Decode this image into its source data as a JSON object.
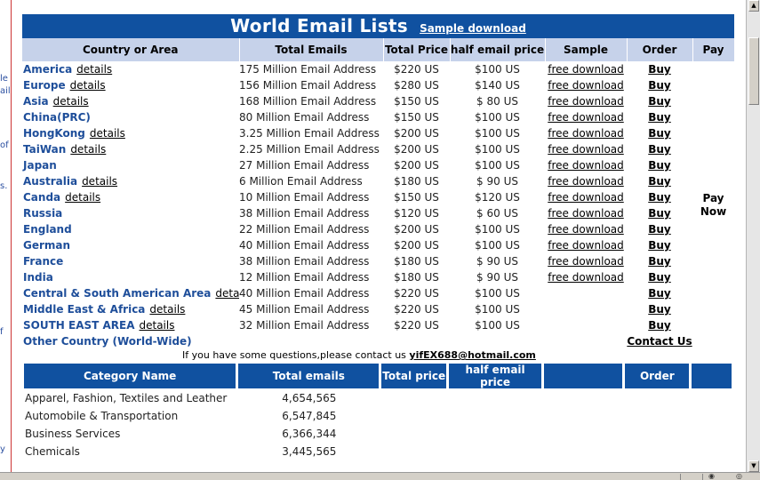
{
  "left_sidebar_fragments": [
    "le",
    "ail",
    "of",
    "s.",
    "f",
    "y"
  ],
  "banner": {
    "title": "World Email Lists",
    "sample_link": "Sample download"
  },
  "headers": [
    "Country or Area",
    "Total Emails",
    "Total Price",
    "half email price",
    "Sample",
    "Order",
    "Pay"
  ],
  "rows": [
    {
      "country": "America",
      "details": "details",
      "total": "175 Million Email Address",
      "price": "$220 US",
      "half": "$100 US",
      "sample": "free download",
      "order": "Buy"
    },
    {
      "country": "Europe",
      "details": "details",
      "total": "156 Million Email Address",
      "price": "$280 US",
      "half": "$140 US",
      "sample": "free download",
      "order": "Buy"
    },
    {
      "country": "Asia",
      "details": "details",
      "total": "168 Million Email Address",
      "price": "$150 US",
      "half": "$  80 US",
      "sample": "free download",
      "order": "Buy"
    },
    {
      "country": "China(PRC)",
      "details": "",
      "total": "80  Million Email Address",
      "price": "$150 US",
      "half": "$100 US",
      "sample": "free download",
      "order": "Buy"
    },
    {
      "country": "HongKong",
      "details": "details",
      "total": "3.25 Million Email Address",
      "price": "$200 US",
      "half": "$100 US",
      "sample": "free download",
      "order": "Buy"
    },
    {
      "country": "TaiWan",
      "details": "details",
      "total": "2.25 Million Email Address",
      "price": "$200 US",
      "half": "$100 US",
      "sample": "free download",
      "order": "Buy"
    },
    {
      "country": "Japan",
      "details": "",
      "total": "27   Million Email Address",
      "price": "$200 US",
      "half": "$100 US",
      "sample": "free download",
      "order": "Buy"
    },
    {
      "country": "Australia",
      "details": "details",
      "total": "6     Million Email Address",
      "price": "$180 US",
      "half": "$ 90 US",
      "sample": "free download",
      "order": "Buy"
    },
    {
      "country": "Canda",
      "details": "details",
      "total": "10   Million Email Address",
      "price": "$150 US",
      "half": "$120 US",
      "sample": "free download",
      "order": "Buy"
    },
    {
      "country": "Russia",
      "details": "",
      "total": "38   Million Email Address",
      "price": "$120 US",
      "half": "$  60 US",
      "sample": "free download",
      "order": "Buy"
    },
    {
      "country": "England",
      "details": "",
      "total": "22  Million Email Address",
      "price": "$200 US",
      "half": "$100 US",
      "sample": "free download",
      "order": "Buy"
    },
    {
      "country": "German",
      "details": "",
      "total": "40   Million Email Address",
      "price": "$200 US",
      "half": "$100 US",
      "sample": "free download",
      "order": "Buy"
    },
    {
      "country": "France",
      "details": "",
      "total": "38   Million Email Address",
      "price": "$180 US",
      "half": "$  90 US",
      "sample": "free download",
      "order": "Buy"
    },
    {
      "country": "India",
      "details": "",
      "total": "12   Million Email Address",
      "price": "$180 US",
      "half": "$  90 US",
      "sample": "free download",
      "order": "Buy"
    },
    {
      "country": "Central & South American Area",
      "details": "details",
      "total": "40   Million Email Address",
      "price": "$220 US",
      "half": "$100 US",
      "sample": "",
      "order": "Buy"
    },
    {
      "country": "Middle East & Africa",
      "details": "details",
      "total": "45   Million Email Address",
      "price": "$220 US",
      "half": "$100 US",
      "sample": "",
      "order": "Buy"
    },
    {
      "country": "SOUTH EAST AREA",
      "details": "details",
      "total": "32  Million Email Address",
      "price": "$220 US",
      "half": "$100 US",
      "sample": "",
      "order": "Buy"
    },
    {
      "country": "Other Country (World-Wide)",
      "details": "",
      "total": "",
      "price": "",
      "half": "",
      "sample": "",
      "order": "Contact Us"
    }
  ],
  "pay_now": "Pay Now",
  "question": {
    "text": "If you have some questions,please contact us",
    "email": "yifEX688@hotmail.com"
  },
  "category_headers": [
    "Category Name",
    "Total emails",
    "Total price",
    "half email price",
    "",
    "Order",
    ""
  ],
  "categories": [
    {
      "name": "Apparel, Fashion, Textiles and Leather",
      "total": "4,654,565"
    },
    {
      "name": "Automobile & Transportation",
      "total": "6,547,845"
    },
    {
      "name": "Business Services",
      "total": "6,366,344"
    },
    {
      "name": "Chemicals",
      "total": "3,445,565"
    }
  ],
  "colors": {
    "banner_blue": "#1051a0",
    "header_light": "#c6d2ea",
    "link_blue": "#1e4e9a",
    "sidebar_red": "#cc3333"
  }
}
